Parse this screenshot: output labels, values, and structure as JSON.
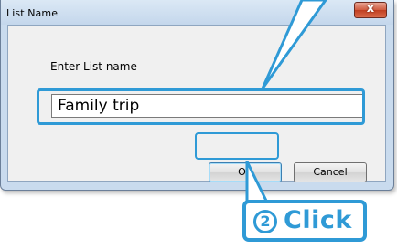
{
  "dialog": {
    "title": "List Name",
    "close_label": "x",
    "prompt": "Enter List name",
    "input_value": "Family trip",
    "ok_label": "OK",
    "cancel_label": "Cancel"
  },
  "callout": {
    "step_number": "2",
    "step_action": "Click",
    "accent_color": "#2f9ad6"
  }
}
